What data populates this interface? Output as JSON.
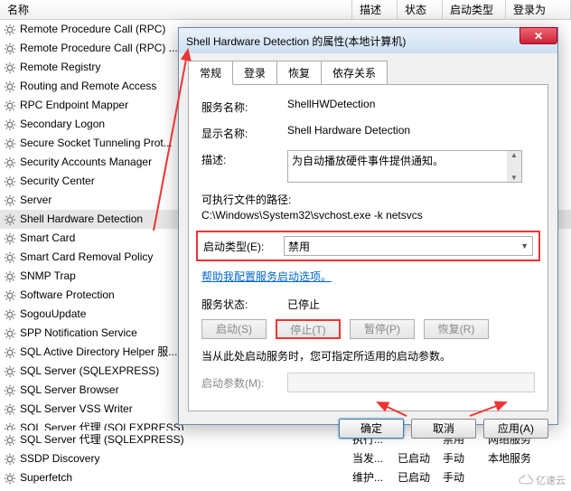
{
  "columns": {
    "name": "名称",
    "desc": "描述",
    "status": "状态",
    "startup": "启动类型",
    "login": "登录为"
  },
  "services": [
    "Remote Procedure Call (RPC)",
    "Remote Procedure Call (RPC) ...",
    "Remote Registry",
    "Routing and Remote Access",
    "RPC Endpoint Mapper",
    "Secondary Logon",
    "Secure Socket Tunneling Prot...",
    "Security Accounts Manager",
    "Security Center",
    "Server",
    "Shell Hardware Detection",
    "Smart Card",
    "Smart Card Removal Policy",
    "SNMP Trap",
    "Software Protection",
    "SogouUpdate",
    "SPP Notification Service",
    "SQL Active Directory Helper 服...",
    "SQL Server (SQLEXPRESS)",
    "SQL Server Browser",
    "SQL Server VSS Writer",
    "SQL Server 代理 (SQLEXPRESS)",
    "SSDP Discovery",
    "Superfetch"
  ],
  "selected_index": 10,
  "extras": [
    {
      "name": "SQL Server 代理 (SQLEXPRESS)",
      "desc": "执行...",
      "status": "",
      "startup": "禁用",
      "login": "网络服务"
    },
    {
      "name": "SSDP Discovery",
      "desc": "当发...",
      "status": "已启动",
      "startup": "手动",
      "login": "本地服务"
    },
    {
      "name": "Superfetch",
      "desc": "维护...",
      "status": "已启动",
      "startup": "手动",
      "login": ""
    }
  ],
  "dlg": {
    "title": "Shell Hardware Detection 的属性(本地计算机)",
    "tabs": [
      "常规",
      "登录",
      "恢复",
      "依存关系"
    ],
    "svc_name_lbl": "服务名称:",
    "svc_name": "ShellHWDetection",
    "disp_name_lbl": "显示名称:",
    "disp_name": "Shell Hardware Detection",
    "desc_lbl": "描述:",
    "desc": "为自动播放硬件事件提供通知。",
    "path_lbl": "可执行文件的路径:",
    "path": "C:\\Windows\\System32\\svchost.exe -k netsvcs",
    "startup_lbl": "启动类型(E):",
    "startup_val": "禁用",
    "help_link": "帮助我配置服务启动选项。",
    "status_lbl": "服务状态:",
    "status_val": "已停止",
    "btns": {
      "start": "启动(S)",
      "stop": "停止(T)",
      "pause": "暂停(P)",
      "resume": "恢复(R)"
    },
    "note": "当从此处启动服务时，您可指定所适用的启动参数。",
    "param_lbl": "启动参数(M):",
    "ok": "确定",
    "cancel": "取消",
    "apply": "应用(A)",
    "close_x": "✕"
  },
  "watermark": "亿速云"
}
